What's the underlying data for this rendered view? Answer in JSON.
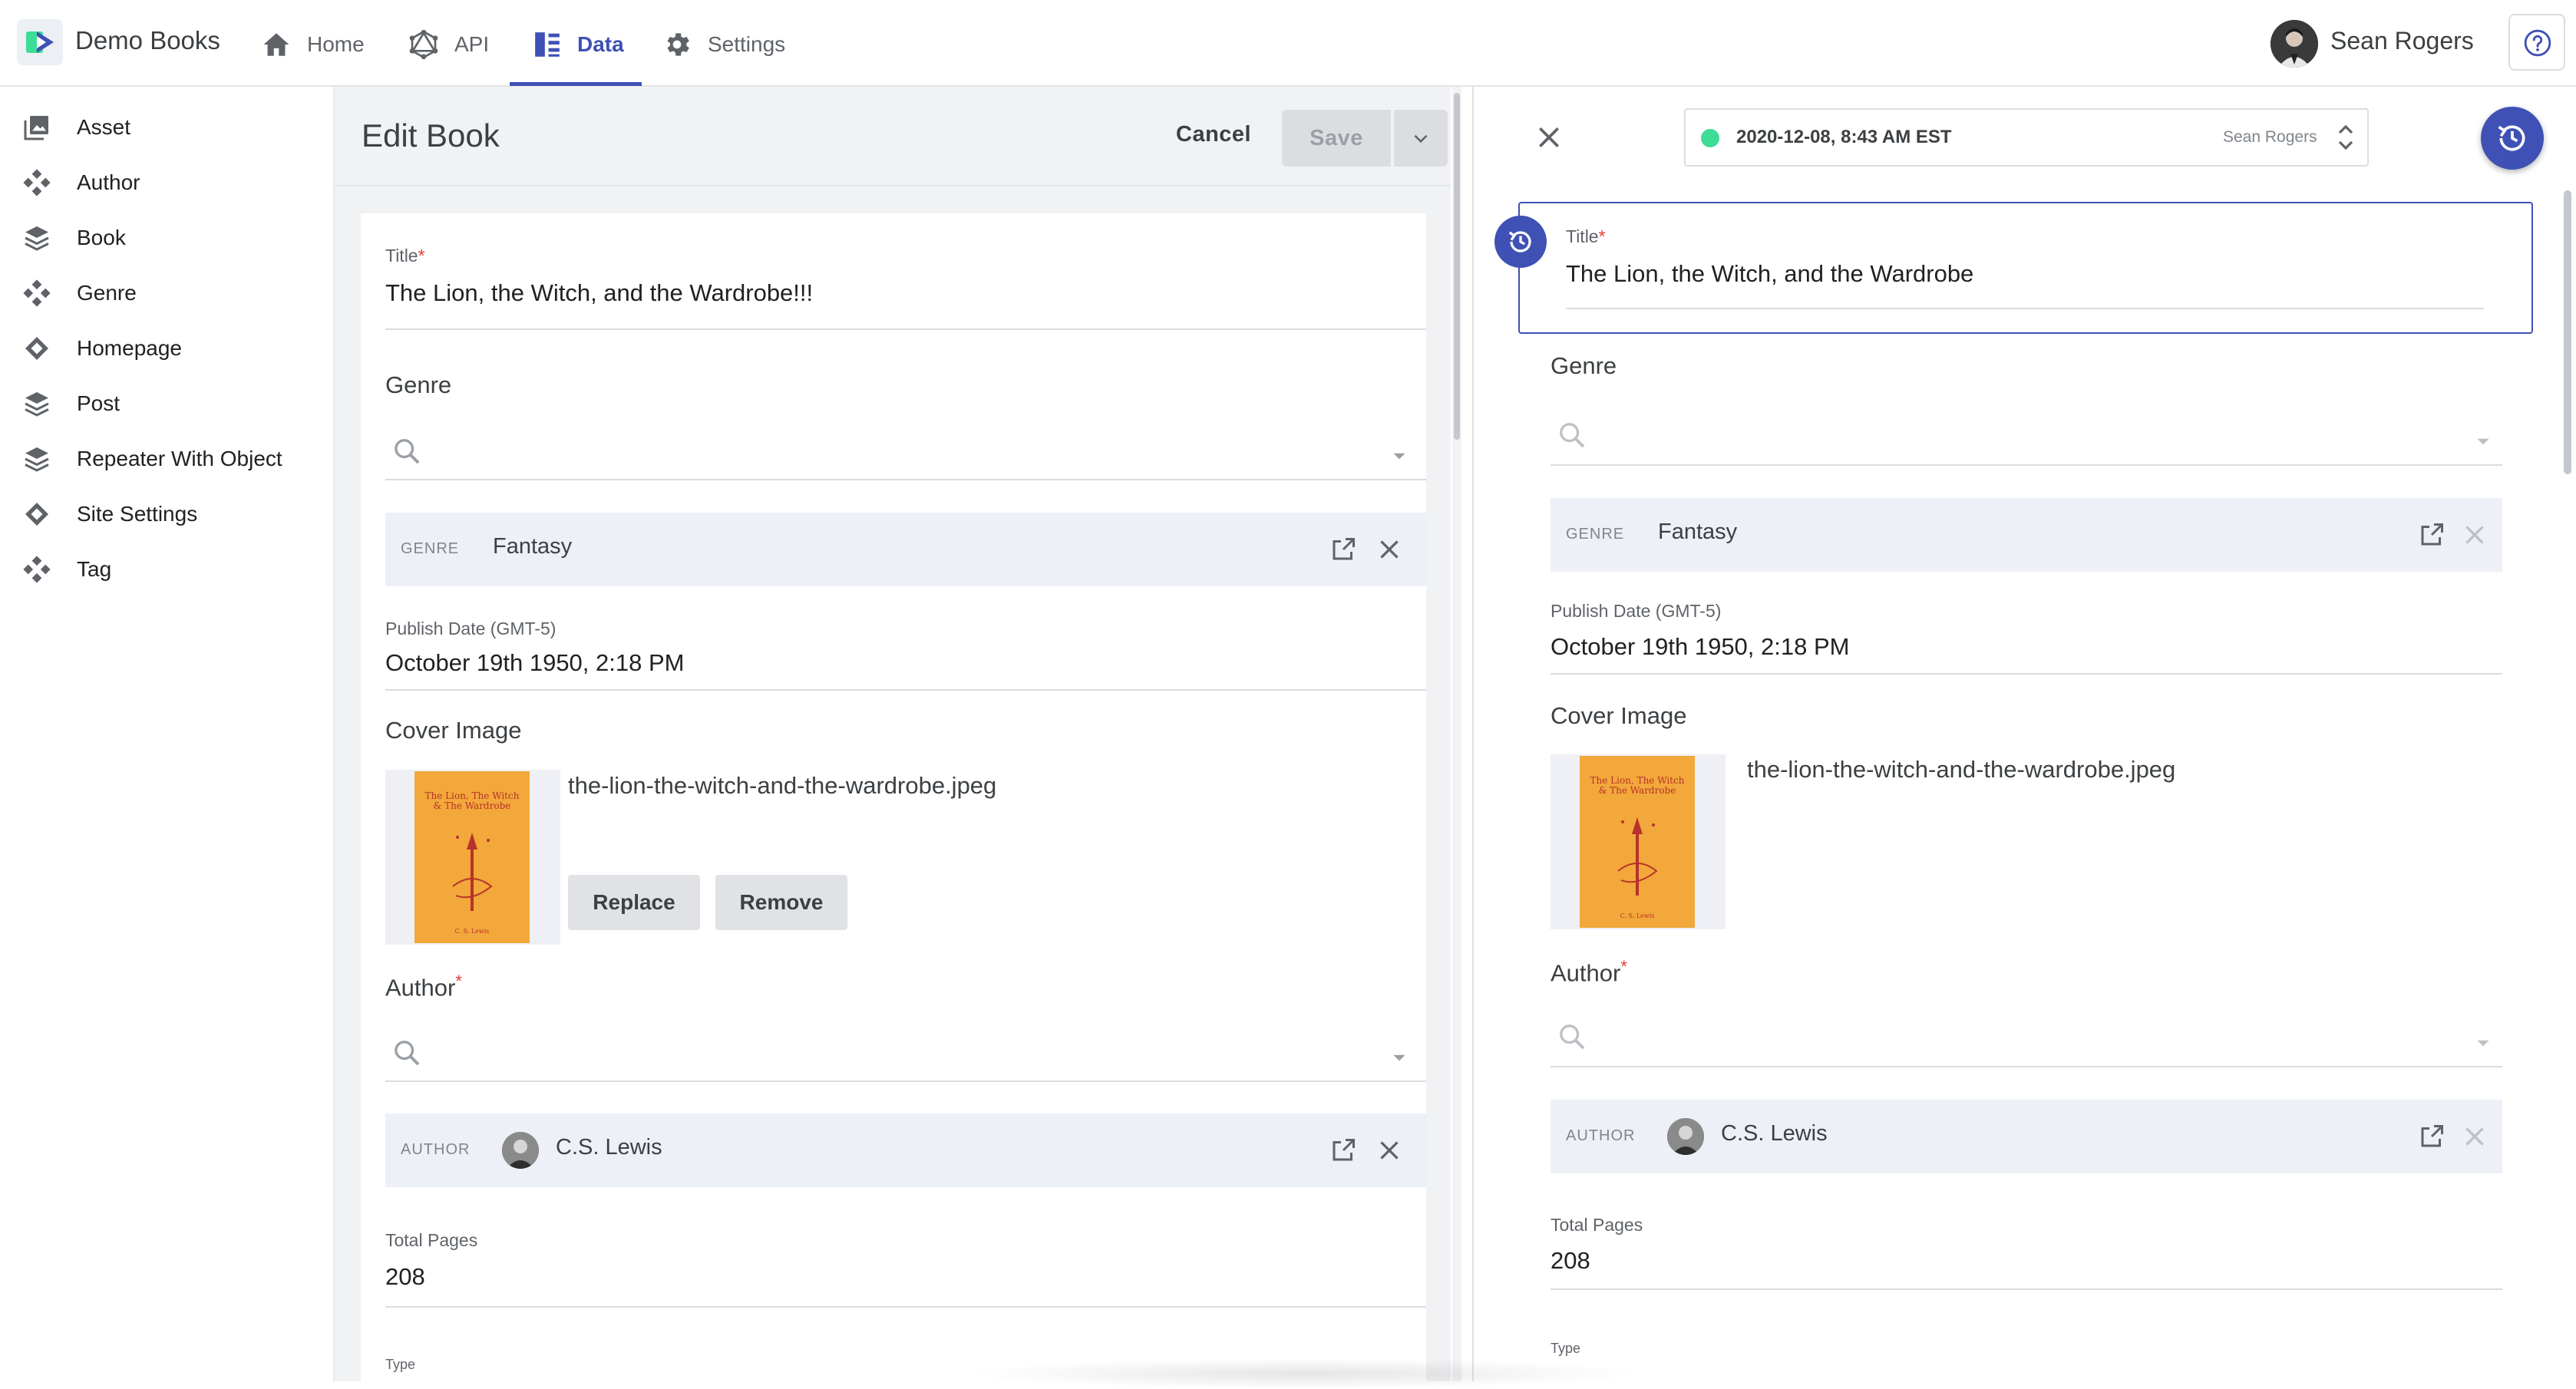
{
  "app": {
    "name": "Demo Books"
  },
  "nav": {
    "home": "Home",
    "api": "API",
    "data": "Data",
    "settings": "Settings"
  },
  "user": {
    "name": "Sean Rogers"
  },
  "sidebar": {
    "items": [
      {
        "label": "Asset",
        "icon": "image-stack-icon"
      },
      {
        "label": "Author",
        "icon": "component-icon"
      },
      {
        "label": "Book",
        "icon": "layers-icon"
      },
      {
        "label": "Genre",
        "icon": "component-icon"
      },
      {
        "label": "Homepage",
        "icon": "diamond-icon"
      },
      {
        "label": "Post",
        "icon": "layers-icon"
      },
      {
        "label": "Repeater With Object",
        "icon": "layers-icon"
      },
      {
        "label": "Site Settings",
        "icon": "diamond-icon"
      },
      {
        "label": "Tag",
        "icon": "component-icon"
      }
    ]
  },
  "editor": {
    "heading": "Edit Book",
    "cancel": "Cancel",
    "save": "Save",
    "title_label": "Title",
    "title_value": "The Lion, the Witch, and the Wardrobe!!!",
    "genre_section": "Genre",
    "genre_kind": "GENRE",
    "genre_value": "Fantasy",
    "publish_label": "Publish Date (GMT-5)",
    "publish_value": "October 19th 1950, 2:18 PM",
    "cover_section": "Cover Image",
    "cover_file": "the-lion-the-witch-and-the-wardrobe.jpeg",
    "replace": "Replace",
    "remove": "Remove",
    "author_section": "Author",
    "author_kind": "AUTHOR",
    "author_value": "C.S. Lewis",
    "pages_label": "Total Pages",
    "pages_value": "208",
    "type_label": "Type"
  },
  "history": {
    "version_date": "2020-12-08, 8:43 AM EST",
    "version_user": "Sean Rogers",
    "title_label": "Title",
    "title_value": "The Lion, the Witch, and the Wardrobe",
    "genre_section": "Genre",
    "genre_kind": "GENRE",
    "genre_value": "Fantasy",
    "publish_label": "Publish Date (GMT-5)",
    "publish_value": "October 19th 1950, 2:18 PM",
    "cover_section": "Cover Image",
    "cover_file": "the-lion-the-witch-and-the-wardrobe.jpeg",
    "author_section": "Author",
    "author_kind": "AUTHOR",
    "author_value": "C.S. Lewis",
    "pages_label": "Total Pages",
    "pages_value": "208",
    "type_label": "Type"
  },
  "book_cover": {
    "title_line1": "The Lion, The Witch",
    "title_line2": "& The Wardrobe",
    "author": "C. S. Lewis"
  },
  "colors": {
    "accent": "#3f51b5",
    "required": "#e53935",
    "status_dot": "#3ddc97",
    "reference_row": "#edf0f7",
    "book_cover": "#f2a83a"
  }
}
